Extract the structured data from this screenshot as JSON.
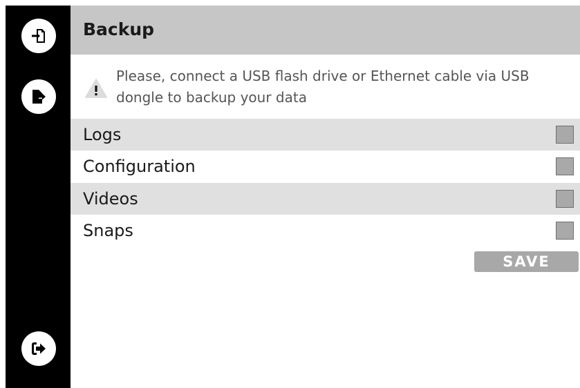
{
  "sidebar": {
    "items": [
      {
        "name": "import-icon"
      },
      {
        "name": "export-icon"
      },
      {
        "name": "logout-icon"
      }
    ]
  },
  "header": {
    "title": "Backup"
  },
  "notice": {
    "icon": "warning-icon",
    "text": "Please, connect a USB flash drive or Ethernet cable via USB dongle to backup your data"
  },
  "options": [
    {
      "label": "Logs",
      "checked": false
    },
    {
      "label": "Configuration",
      "checked": false
    },
    {
      "label": "Videos",
      "checked": false
    },
    {
      "label": "Snaps",
      "checked": false
    }
  ],
  "actions": {
    "save_label": "SAVE"
  },
  "colors": {
    "sidebar_bg": "#000000",
    "header_bg": "#c6c6c6",
    "row_shaded_bg": "#e0e0e0",
    "checkbox_fill": "#a9a9a9",
    "save_button_bg": "#a8a8a8"
  }
}
